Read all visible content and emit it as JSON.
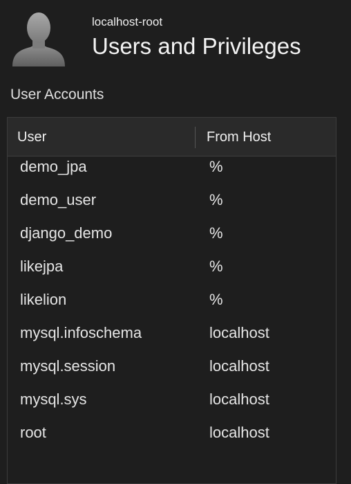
{
  "header": {
    "connection_name": "localhost-root",
    "title": "Users and Privileges"
  },
  "accounts": {
    "section_title": "User Accounts",
    "columns": {
      "user": "User",
      "host": "From Host"
    },
    "rows": [
      {
        "user": "demo_jpa",
        "host": "%"
      },
      {
        "user": "demo_user",
        "host": "%"
      },
      {
        "user": "django_demo",
        "host": "%"
      },
      {
        "user": "likejpa",
        "host": "%"
      },
      {
        "user": "likelion",
        "host": "%"
      },
      {
        "user": "mysql.infoschema",
        "host": "localhost"
      },
      {
        "user": "mysql.session",
        "host": "localhost"
      },
      {
        "user": "mysql.sys",
        "host": "localhost"
      },
      {
        "user": "root",
        "host": "localhost"
      }
    ]
  },
  "icons": {
    "avatar": "user-silhouette-icon"
  }
}
